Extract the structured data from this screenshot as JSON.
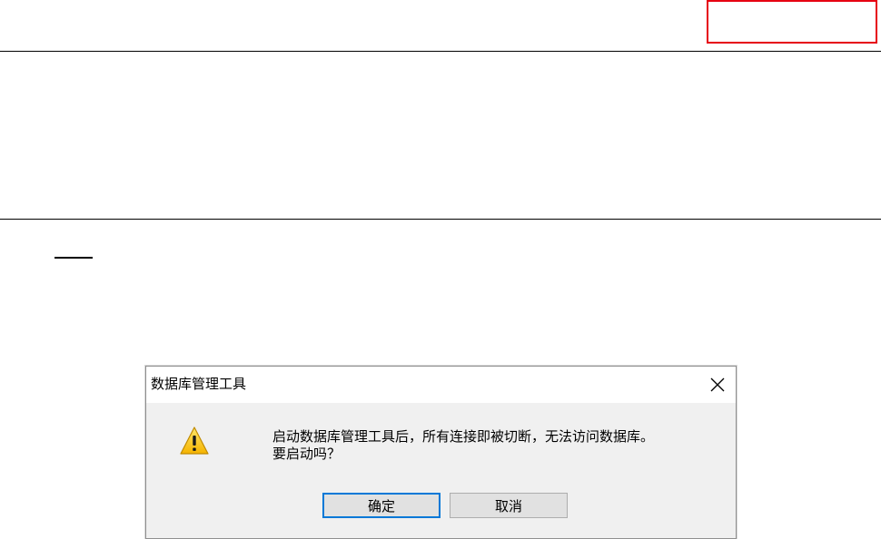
{
  "dialog": {
    "title": "数据库管理工具",
    "message_line1": "启动数据库管理工具后，所有连接即被切断，无法访问数据库。",
    "message_line2": "要启动吗？",
    "ok_label": "确定",
    "cancel_label": "取消",
    "icon": "warning-icon",
    "close_icon": "close-icon"
  },
  "colors": {
    "highlight_box": "#e60012",
    "default_button_border": "#0078d7",
    "dialog_background": "#f0f0f0"
  }
}
